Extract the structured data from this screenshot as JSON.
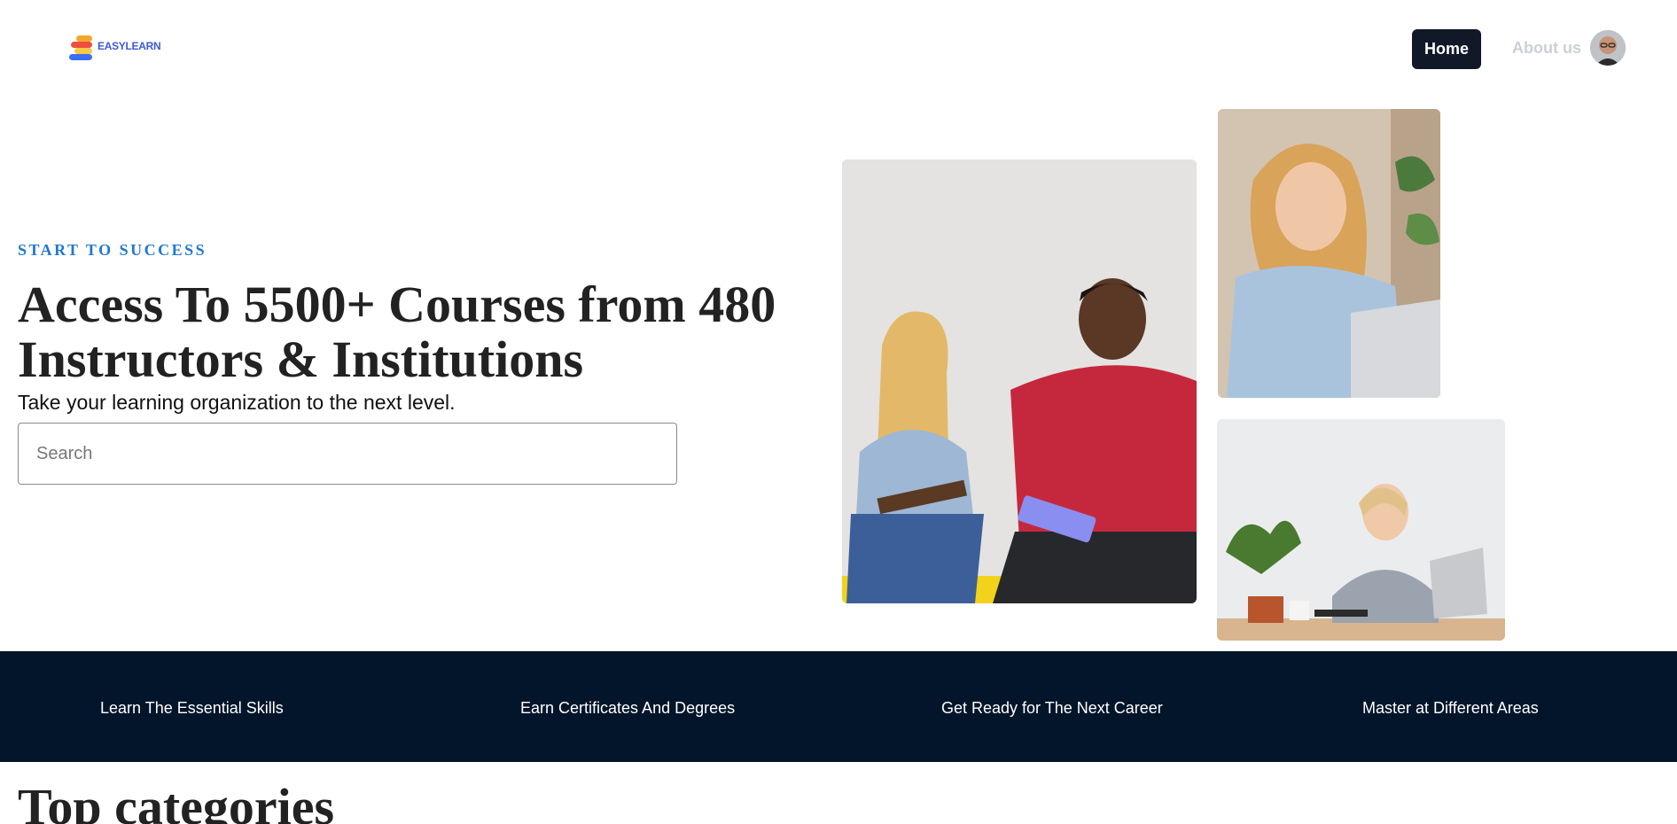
{
  "brand": {
    "name": "EASYLEARN"
  },
  "nav": {
    "home_label": "Home",
    "about_label": "About us"
  },
  "hero": {
    "eyebrow": "START TO SUCCESS",
    "title": "Access To 5500+ Courses from 480 Instructors & Institutions",
    "subtitle": "Take your learning organization to the next level.",
    "search_placeholder": "Search"
  },
  "banner": {
    "items": [
      "Learn The Essential Skills",
      "Earn Certificates And Degrees",
      "Get Ready for The Next Career",
      "Master at Different Areas"
    ]
  },
  "sections": {
    "top_categories_title": "Top categories"
  },
  "colors": {
    "accent": "#1f78d1",
    "nav_active": "#111827",
    "banner_bg": "#03152a"
  }
}
